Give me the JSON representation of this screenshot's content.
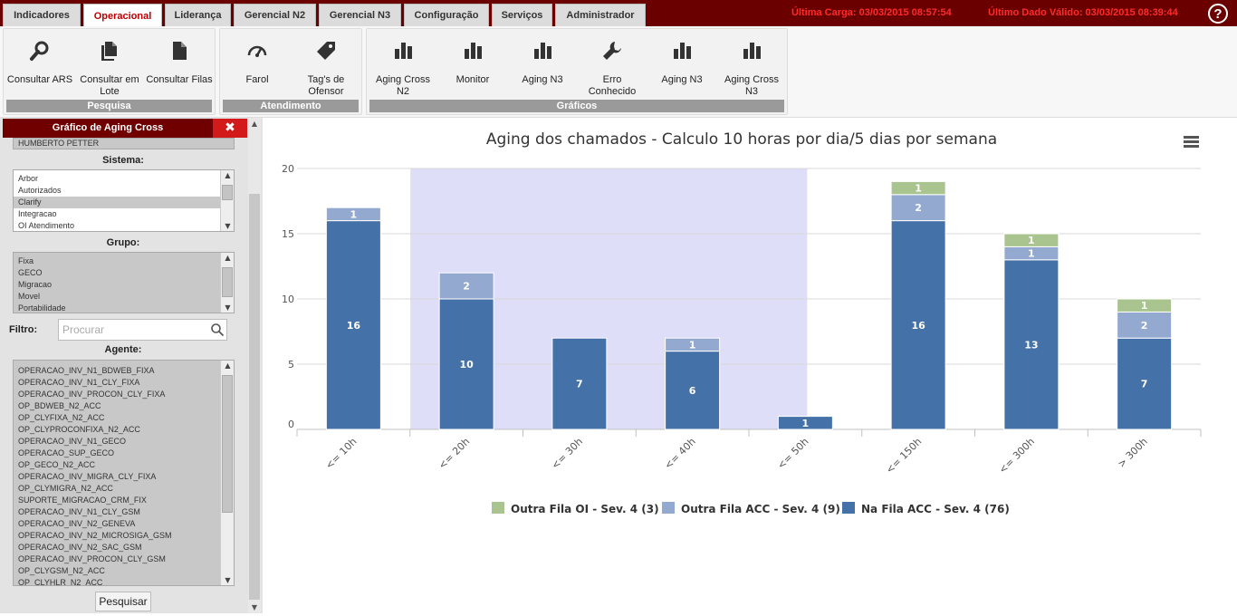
{
  "tabs": [
    {
      "label": "Indicadores",
      "active": false
    },
    {
      "label": "Operacional",
      "active": true
    },
    {
      "label": "Liderança",
      "active": false
    },
    {
      "label": "Gerencial N2",
      "active": false
    },
    {
      "label": "Gerencial N3",
      "active": false
    },
    {
      "label": "Configuração",
      "active": false
    },
    {
      "label": "Serviços",
      "active": false
    },
    {
      "label": "Administrador",
      "active": false
    }
  ],
  "header": {
    "ultima_carga": "Última Carga: 03/03/2015 08:57:54",
    "ultimo_dado": "Último Dado Válido: 03/03/2015 08:39:44",
    "help": "?"
  },
  "ribbon": {
    "pesquisa": {
      "label": "Pesquisa",
      "buttons": [
        {
          "label": "Consultar ARS",
          "icon": "search-icon"
        },
        {
          "label": "Consultar em Lote",
          "icon": "documents-icon"
        },
        {
          "label": "Consultar Filas",
          "icon": "document-icon"
        }
      ]
    },
    "atendimento": {
      "label": "Atendimento",
      "buttons": [
        {
          "label": "Farol",
          "icon": "gauge-icon"
        },
        {
          "label": "Tag's de Ofensor",
          "icon": "tag-icon"
        }
      ]
    },
    "graficos": {
      "label": "Gráficos",
      "buttons": [
        {
          "label": "Aging Cross N2",
          "icon": "bar-chart-icon"
        },
        {
          "label": "Monitor",
          "icon": "bar-chart-icon"
        },
        {
          "label": "Aging N3",
          "icon": "bar-chart-icon"
        },
        {
          "label": "Erro Conhecido",
          "icon": "wrench-icon"
        },
        {
          "label": "Aging N3",
          "icon": "bar-chart-icon"
        },
        {
          "label": "Aging Cross N3",
          "icon": "bar-chart-icon"
        }
      ]
    }
  },
  "panel": {
    "title": "Gráfico de Aging Cross",
    "close": "✖",
    "top_partial_item": "HUMBERTO PETTER",
    "sistema_label": "Sistema:",
    "sistema_items": [
      "Arbor",
      "Autorizados",
      "Clarify",
      "Integracao",
      "OI Atendimento"
    ],
    "sistema_selected": "Clarify",
    "grupo_label": "Grupo:",
    "grupo_items": [
      "Fixa",
      "GECO",
      "Migracao",
      "Movel",
      "Portabilidade"
    ],
    "filtro_label": "Filtro:",
    "filtro_placeholder": "Procurar",
    "agente_label": "Agente:",
    "agente_items": [
      "OPERACAO_INV_N1_BDWEB_FIXA",
      "OPERACAO_INV_N1_CLY_FIXA",
      "OPERACAO_INV_PROCON_CLY_FIXA",
      "OP_BDWEB_N2_ACC",
      "OP_CLYFIXA_N2_ACC",
      "OP_CLYPROCONFIXA_N2_ACC",
      "OPERACAO_INV_N1_GECO",
      "OPERACAO_SUP_GECO",
      "OP_GECO_N2_ACC",
      "OPERACAO_INV_MIGRA_CLY_FIXA",
      "OP_CLYMIGRA_N2_ACC",
      "SUPORTE_MIGRACAO_CRM_FIX",
      "OPERACAO_INV_N1_CLY_GSM",
      "OPERACAO_INV_N2_GENEVA",
      "OPERACAO_INV_N2_MICROSIGA_GSM",
      "OPERACAO_INV_N2_SAC_GSM",
      "OPERACAO_INV_PROCON_CLY_GSM",
      "OP_CLYGSM_N2_ACC",
      "OP_CLYHLR_N2_ACC"
    ],
    "pesquisar": "Pesquisar"
  },
  "chart_data": {
    "type": "bar",
    "stacked": true,
    "title": "Aging dos chamados - Calculo 10 horas por dia/5 dias por semana",
    "categories": [
      "<= 10h",
      "<= 20h",
      "<= 30h",
      "<= 40h",
      "<= 50h",
      "<= 150h",
      "<= 300h",
      "> 300h"
    ],
    "series": [
      {
        "name": "Na Fila ACC - Sev. 4 (76)",
        "color": "#4472a8",
        "values": [
          16,
          10,
          7,
          6,
          1,
          16,
          13,
          7
        ]
      },
      {
        "name": "Outra Fila ACC - Sev. 4 (9)",
        "color": "#93a9cf",
        "values": [
          1,
          2,
          0,
          1,
          0,
          2,
          1,
          2
        ]
      },
      {
        "name": "Outra Fila OI - Sev. 4 (3)",
        "color": "#a9c48f",
        "values": [
          0,
          0,
          0,
          0,
          0,
          1,
          1,
          1
        ]
      }
    ],
    "legend_order": [
      2,
      1,
      0
    ],
    "ylim": [
      0,
      20
    ],
    "yticks": [
      0,
      5,
      10,
      15,
      20
    ],
    "highlight_band": {
      "from_category": 1,
      "to_category": 4,
      "color": "#dedef8"
    },
    "grid": true,
    "legend_position": "bottom-center"
  }
}
